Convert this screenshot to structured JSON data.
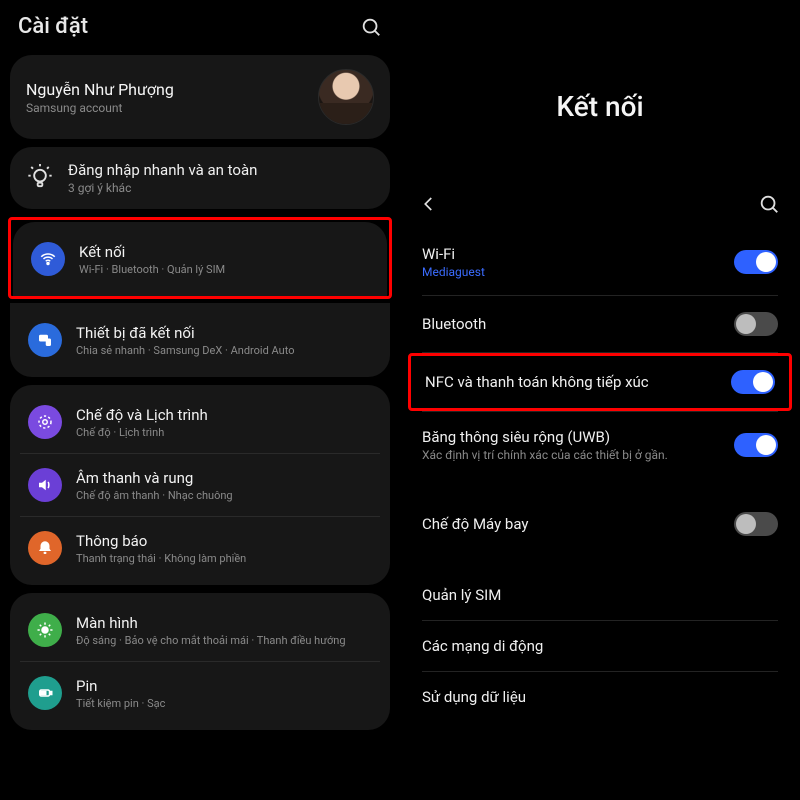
{
  "left": {
    "title": "Cài đặt",
    "account": {
      "name": "Nguyễn Như Phượng",
      "sub": "Samsung account"
    },
    "quick": {
      "title": "Đăng nhập nhanh và an toàn",
      "sub": "3 gợi ý khác"
    },
    "group1": {
      "connections": {
        "title": "Kết nối",
        "sub": "Wi-Fi · Bluetooth · Quản lý SIM"
      },
      "devices": {
        "title": "Thiết bị đã kết nối",
        "sub": "Chia sẻ nhanh · Samsung DeX · Android Auto"
      }
    },
    "group2": {
      "modes": {
        "title": "Chế độ và Lịch trình",
        "sub": "Chế độ · Lịch trình"
      },
      "sound": {
        "title": "Âm thanh và rung",
        "sub": "Chế độ âm thanh · Nhạc chuông"
      },
      "notif": {
        "title": "Thông báo",
        "sub": "Thanh trạng thái · Không làm phiền"
      }
    },
    "group3": {
      "display": {
        "title": "Màn hình",
        "sub": "Độ sáng · Bảo vệ cho mắt thoải mái · Thanh điều hướng"
      },
      "battery": {
        "title": "Pin",
        "sub": "Tiết kiệm pin · Sạc"
      }
    }
  },
  "right": {
    "hero": "Kết nối",
    "wifi": {
      "title": "Wi-Fi",
      "sub": "Mediaguest",
      "on": true
    },
    "bt": {
      "title": "Bluetooth",
      "on": false
    },
    "nfc": {
      "title": "NFC và thanh toán không tiếp xúc",
      "on": true
    },
    "uwb": {
      "title": "Băng thông siêu rộng (UWB)",
      "sub": "Xác định vị trí chính xác của các thiết bị ở gần.",
      "on": true
    },
    "airplane": {
      "title": "Chế độ Máy bay",
      "on": false
    },
    "sim": {
      "title": "Quản lý SIM"
    },
    "mobile": {
      "title": "Các mạng di động"
    },
    "data": {
      "title": "Sử dụng dữ liệu"
    }
  }
}
